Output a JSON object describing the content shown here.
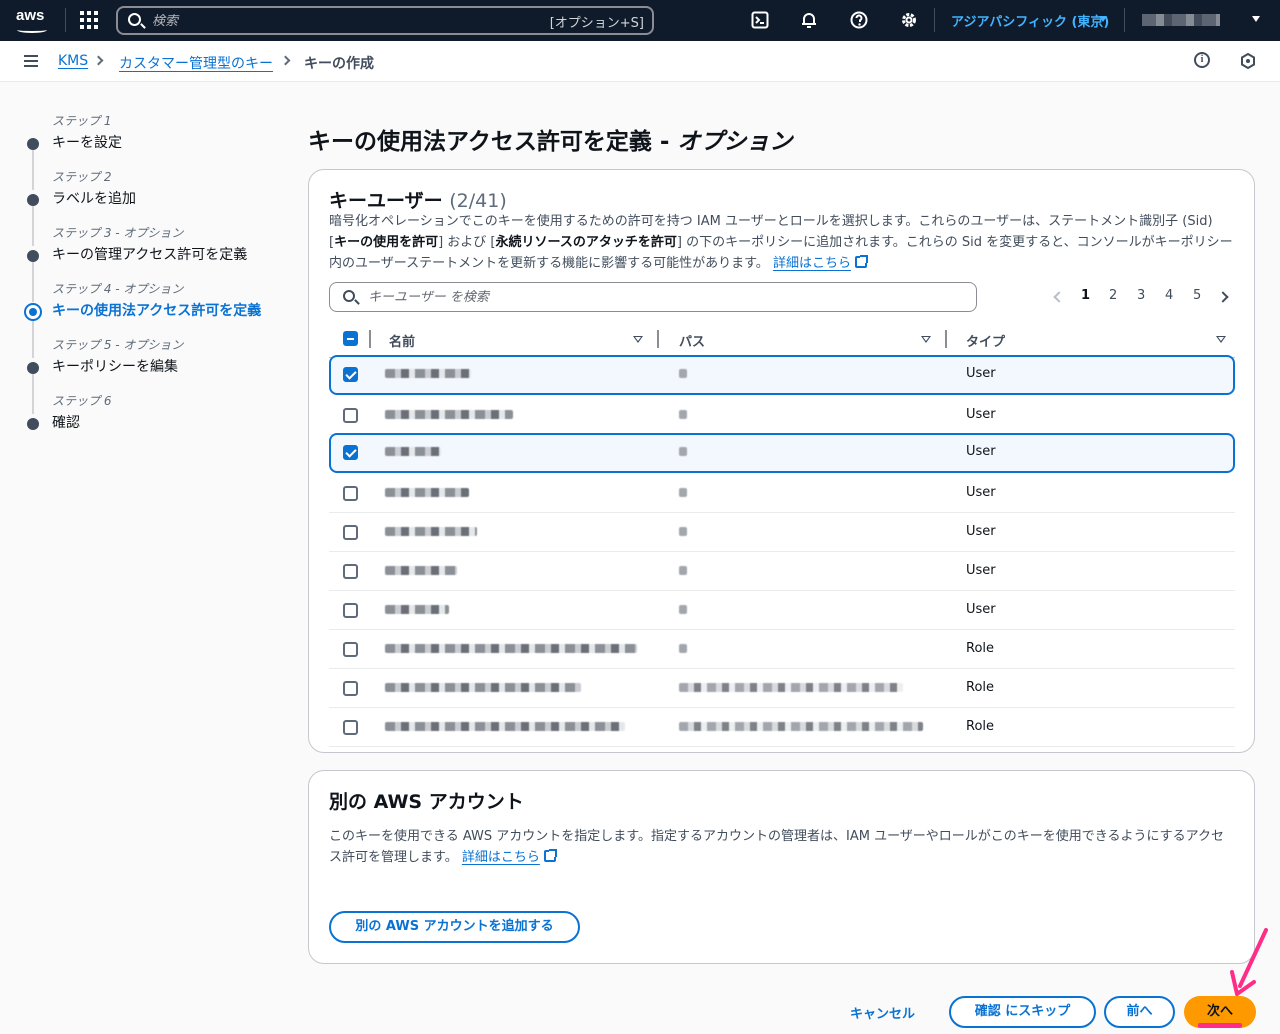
{
  "nav": {
    "search_placeholder": "検索",
    "search_shortcut": "[オプション+S]",
    "region": "アジアパシフィック (東京)",
    "icons": [
      "cloudshell-icon",
      "bell-icon",
      "help-icon",
      "settings-icon"
    ]
  },
  "breadcrumb": {
    "items": [
      "KMS",
      "カスタマー管理型のキー",
      "キーの作成"
    ]
  },
  "steps": [
    {
      "label": "ステップ 1",
      "name": "キーを設定"
    },
    {
      "label": "ステップ 2",
      "name": "ラベルを追加"
    },
    {
      "label": "ステップ 3 - オプション",
      "name": "キーの管理アクセス許可を定義"
    },
    {
      "label": "ステップ 4 - オプション",
      "name": "キーの使用法アクセス許可を定義"
    },
    {
      "label": "ステップ 5 - オプション",
      "name": "キーポリシーを編集"
    },
    {
      "label": "ステップ 6",
      "name": "確認"
    }
  ],
  "page": {
    "title_main": "キーの使用法アクセス許可を定義 - ",
    "title_optional": "オプション"
  },
  "key_users": {
    "title": "キーユーザー",
    "count": "(2/41)",
    "desc_1": "暗号化オペレーションでこのキーを使用するための許可を持つ IAM ユーザーとロールを選択します。これらのユーザーは、ステートメント識別子 (Sid) [",
    "desc_b1": "キーの使用を許可",
    "desc_2": "] および [",
    "desc_b2": "永続リソースのアタッチを許可",
    "desc_3": "] の下のキーポリシーに追加されます。これらの Sid を変更すると、コンソールがキーポリシー内のユーザーステートメントを更新する機能に影響する可能性があります。",
    "learn_more": "詳細はこちら",
    "search_placeholder": "キーユーザー を検索",
    "pages": [
      "1",
      "2",
      "3",
      "4",
      "5"
    ],
    "columns": [
      "名前",
      "パス",
      "タイプ"
    ],
    "rows": [
      {
        "selected": true,
        "type": "User"
      },
      {
        "selected": false,
        "type": "User"
      },
      {
        "selected": true,
        "type": "User"
      },
      {
        "selected": false,
        "type": "User"
      },
      {
        "selected": false,
        "type": "User"
      },
      {
        "selected": false,
        "type": "User"
      },
      {
        "selected": false,
        "type": "User"
      },
      {
        "selected": false,
        "type": "Role"
      },
      {
        "selected": false,
        "type": "Role"
      },
      {
        "selected": false,
        "type": "Role"
      }
    ]
  },
  "other_accounts": {
    "title": "別の AWS アカウント",
    "desc": "このキーを使用できる AWS アカウントを指定します。指定するアカウントの管理者は、IAM ユーザーやロールがこのキーを使用できるようにするアクセス許可を管理します。",
    "learn_more": "詳細はこちら",
    "add_button": "別の AWS アカウントを追加する"
  },
  "footer": {
    "cancel": "キャンセル",
    "skip": "確認 にスキップ",
    "prev": "前へ",
    "next": "次へ"
  },
  "colors": {
    "accent": "#0972d3",
    "primary_button": "#ff9900",
    "annotation": "#ff2d87"
  }
}
